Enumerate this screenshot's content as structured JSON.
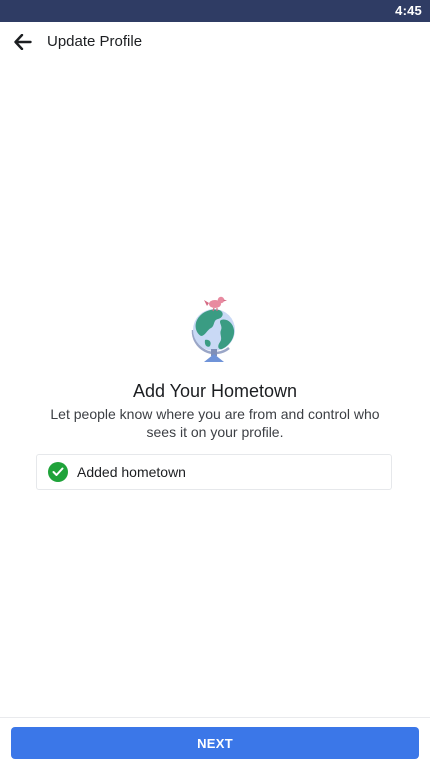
{
  "status_bar": {
    "time": "4:45"
  },
  "app_bar": {
    "title": "Update Profile",
    "back_icon": "arrow-left-icon"
  },
  "content": {
    "illustration_icon": "globe-with-bird-icon",
    "heading": "Add Your Hometown",
    "description": "Let people know where you are from and control who sees it on your profile.",
    "status_item": {
      "icon": "check-circle-icon",
      "label": "Added hometown"
    }
  },
  "footer": {
    "next_label": "NEXT"
  },
  "colors": {
    "status_bar": "#2f3c64",
    "primary_button": "#3b77e8",
    "success_green": "#1fa33a"
  }
}
